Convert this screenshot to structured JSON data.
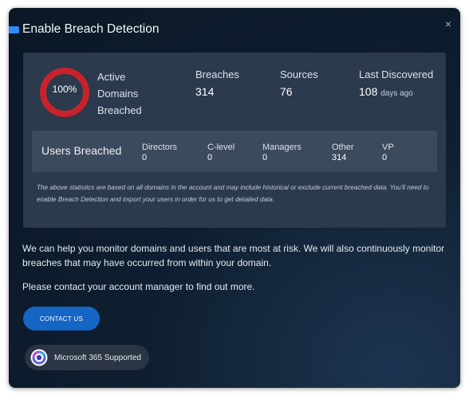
{
  "dialog": {
    "title": "Enable Breach Detection",
    "close_glyph": "×"
  },
  "stats": {
    "active_percent": 100,
    "active_percent_label": "100%",
    "active_label": "Active Domains Breached",
    "breaches_label": "Breaches",
    "breaches_value": "314",
    "sources_label": "Sources",
    "sources_value": "76",
    "last_discovered_label": "Last Discovered",
    "last_discovered_value": "108",
    "last_discovered_unit": "days ago"
  },
  "users": {
    "title": "Users Breached",
    "roles": [
      {
        "label": "Directors",
        "value": "0"
      },
      {
        "label": "C-level",
        "value": "0"
      },
      {
        "label": "Managers",
        "value": "0"
      },
      {
        "label": "Other",
        "value": "314"
      },
      {
        "label": "VP",
        "value": "0"
      }
    ]
  },
  "note": "The above statistics are based on all domains in the account and may include historical or exclude current breached data. You'll need to enable Breach Detection and import your users in order for us to get detailed data.",
  "body": {
    "paragraph1": "We can help you monitor domains and users that are most at risk. We will also continuously monitor breaches that may have occurred from within your domain.",
    "paragraph2": "Please contact your account manager to find out more."
  },
  "actions": {
    "contact_label": "CONTACT US",
    "ms_label": "Microsoft 365 Supported"
  },
  "colors": {
    "ring_fill": "#c8232c",
    "accent": "#1465c4",
    "title_marker": "#2f8bff"
  },
  "icons": {
    "close": "close-icon",
    "microsoft": "microsoft-365-icon"
  }
}
